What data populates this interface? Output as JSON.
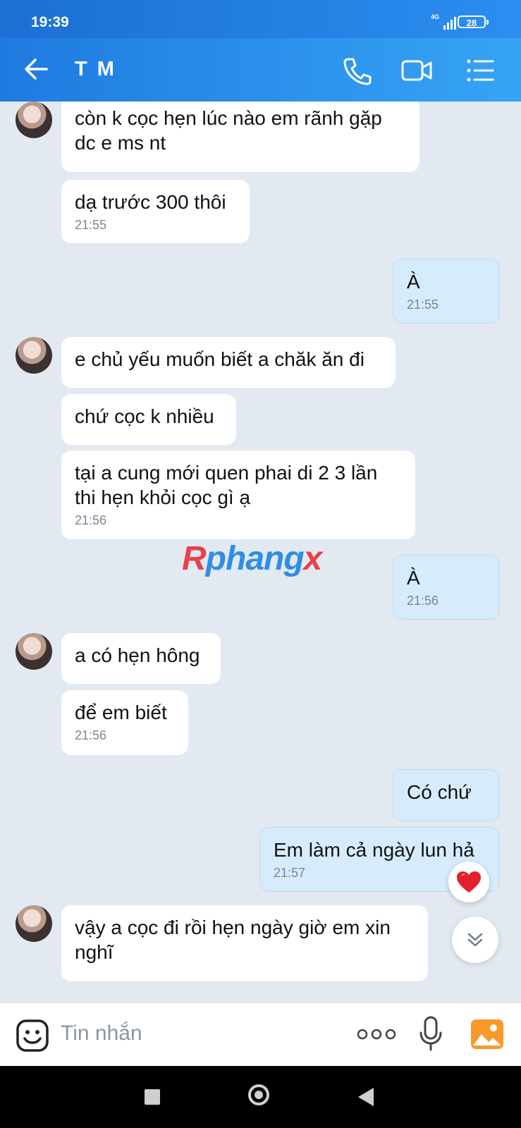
{
  "status": {
    "time": "19:39",
    "network": "4G",
    "battery": "28"
  },
  "header": {
    "title": "T M"
  },
  "messages": [
    {
      "text": "còn k cọc hẹn lúc nào em rãnh gặp dc e ms nt",
      "time": ""
    },
    {
      "text": "dạ trước 300 thôi",
      "time": "21:55"
    },
    {
      "text": "À",
      "time": "21:55"
    },
    {
      "text": "e chủ yếu muốn biết a chăk ăn đi",
      "time": ""
    },
    {
      "text": "chứ cọc k nhiều",
      "time": ""
    },
    {
      "text": "tại a cung mới quen phai di 2 3 lần thi hẹn khỏi cọc gì ạ",
      "time": "21:56"
    },
    {
      "text": "À",
      "time": "21:56"
    },
    {
      "text": "a có hẹn hông",
      "time": ""
    },
    {
      "text": "để em biết",
      "time": "21:56"
    },
    {
      "text": "Có chứ",
      "time": ""
    },
    {
      "text": "Em làm cả ngày lun hả",
      "time": "21:57"
    },
    {
      "text": "vậy a cọc đi rồi hẹn ngày giờ em xin nghĩ",
      "time": ""
    }
  ],
  "watermark": {
    "part1": "R",
    "part2": "phang",
    "part3": "x"
  },
  "composer": {
    "placeholder": "Tin nhắn"
  },
  "colors": {
    "header": "#2a8ef0",
    "outgoing_bubble": "#d6ecfc",
    "incoming_bubble": "#ffffff",
    "background": "#e2e9f1"
  }
}
